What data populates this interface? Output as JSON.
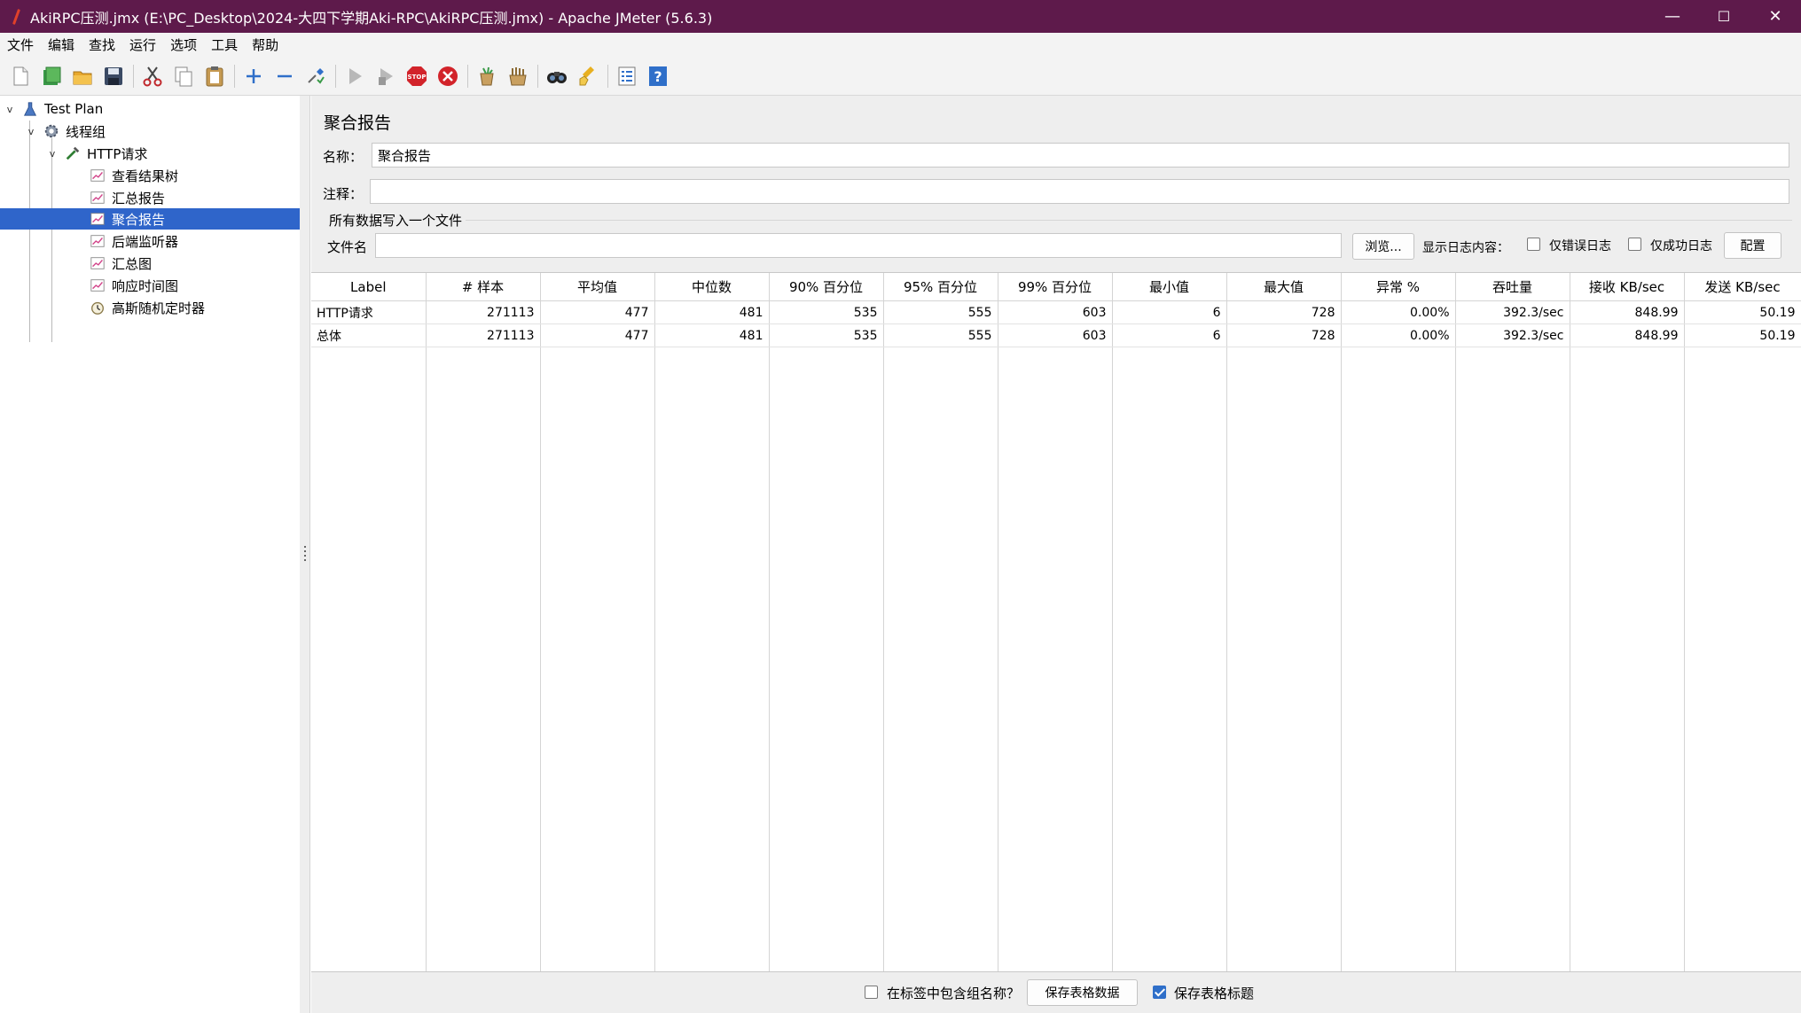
{
  "window": {
    "title": "AkiRPC压测.jmx (E:\\PC_Desktop\\2024-大四下学期Aki-RPC\\AkiRPC压测.jmx) - Apache JMeter (5.6.3)",
    "minimize": "—",
    "maximize": "☐",
    "close": "✕"
  },
  "menu": [
    "文件",
    "编辑",
    "查找",
    "运行",
    "选项",
    "工具",
    "帮助"
  ],
  "toolbar_icons": [
    "new-icon",
    "templates-icon",
    "open-icon",
    "save-icon",
    "cut-icon",
    "copy-icon",
    "paste-icon",
    "expand-icon",
    "collapse-icon",
    "toggle-icon",
    "start-icon",
    "start-no-pauses-icon",
    "stop-icon",
    "shutdown-icon",
    "clear-icon",
    "clear-all-icon",
    "search-icon",
    "reset-search-icon",
    "function-helper-icon",
    "help-icon"
  ],
  "tree": {
    "test_plan": "Test Plan",
    "thread_group": "线程组",
    "http_request": "HTTP请求",
    "children": [
      "查看结果树",
      "汇总报告",
      "聚合报告",
      "后端监听器",
      "汇总图",
      "响应时间图",
      "高斯随机定时器"
    ],
    "selected": "聚合报告"
  },
  "panel": {
    "title": "聚合报告",
    "name_label": "名称：",
    "name_value": "聚合报告",
    "comment_label": "注释：",
    "comment_value": "",
    "file_section": "所有数据写入一个文件",
    "filename_label": "文件名",
    "filename_value": "",
    "browse_button": "浏览...",
    "log_label": "显示日志内容：",
    "errors_only": "仅错误日志",
    "success_only": "仅成功日志",
    "configure_button": "配置"
  },
  "table": {
    "headers": [
      "Label",
      "# 样本",
      "平均值",
      "中位数",
      "90% 百分位",
      "95% 百分位",
      "99% 百分位",
      "最小值",
      "最大值",
      "异常 %",
      "吞吐量",
      "接收 KB/sec",
      "发送 KB/sec"
    ],
    "rows": [
      [
        "HTTP请求",
        "271113",
        "477",
        "481",
        "535",
        "555",
        "603",
        "6",
        "728",
        "0.00%",
        "392.3/sec",
        "848.99",
        "50.19"
      ],
      [
        "总体",
        "271113",
        "477",
        "481",
        "535",
        "555",
        "603",
        "6",
        "728",
        "0.00%",
        "392.3/sec",
        "848.99",
        "50.19"
      ]
    ]
  },
  "bottom": {
    "include_group_name": "在标签中包含组名称？",
    "include_group_name_checked": false,
    "save_table_data": "保存表格数据",
    "save_table_header": "保存表格标题",
    "save_table_header_checked": true
  }
}
